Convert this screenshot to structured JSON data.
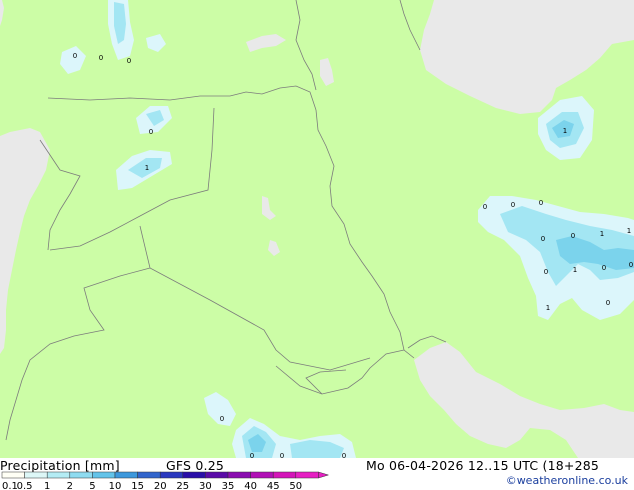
{
  "title": "Precipitation [mm]",
  "model": "GFS 0.25",
  "valid_time": "Mo 06-04-2026 12..15 UTC (18+285",
  "credit": "©weatheronline.co.uk",
  "legend": {
    "labels": [
      "0.1",
      "0.5",
      "1",
      "2",
      "5",
      "10",
      "15",
      "20",
      "25",
      "30",
      "35",
      "40",
      "45",
      "50"
    ],
    "colors": [
      "#fffff5",
      "#ddf7f7",
      "#b4ecf4",
      "#8edbf0",
      "#63c3e9",
      "#3d98dc",
      "#3265cc",
      "#2b38bf",
      "#2a0ea8",
      "#5a0aa8",
      "#8a0cb0",
      "#b10fb6",
      "#d414b9",
      "#e61fc3"
    ]
  },
  "colors": {
    "land": "#ccfda6",
    "sea": "#e9e9e9",
    "precip_light": "#dcf6fb",
    "precip_mid": "#a3e6f3",
    "precip_strong": "#7bd3ec",
    "border": "#7c7c7c"
  },
  "markers": [
    {
      "label": "0",
      "lon": 75,
      "lat": 55
    },
    {
      "label": "0",
      "lon": 101,
      "lat": 57
    },
    {
      "label": "0",
      "lon": 129,
      "lat": 60
    },
    {
      "label": "0",
      "lon": 151,
      "lat": 131
    },
    {
      "label": "1",
      "lon": 147,
      "lat": 167
    },
    {
      "label": "1",
      "lon": 565,
      "lat": 130
    },
    {
      "label": "0",
      "lon": 485,
      "lat": 206
    },
    {
      "label": "0",
      "lon": 513,
      "lat": 204
    },
    {
      "label": "0",
      "lon": 541,
      "lat": 202
    },
    {
      "label": "0",
      "lon": 543,
      "lat": 238
    },
    {
      "label": "0",
      "lon": 573,
      "lat": 235
    },
    {
      "label": "1",
      "lon": 602,
      "lat": 233
    },
    {
      "label": "1",
      "lon": 629,
      "lat": 230
    },
    {
      "label": "0",
      "lon": 546,
      "lat": 271
    },
    {
      "label": "1",
      "lon": 575,
      "lat": 269
    },
    {
      "label": "0",
      "lon": 604,
      "lat": 267
    },
    {
      "label": "0",
      "lon": 631,
      "lat": 264
    },
    {
      "label": "1",
      "lon": 548,
      "lat": 307
    },
    {
      "label": "0",
      "lon": 608,
      "lat": 302
    },
    {
      "label": "0",
      "lon": 222,
      "lat": 418
    },
    {
      "label": "0",
      "lon": 252,
      "lat": 455
    },
    {
      "label": "0",
      "lon": 282,
      "lat": 455
    },
    {
      "label": "0",
      "lon": 344,
      "lat": 455
    }
  ]
}
